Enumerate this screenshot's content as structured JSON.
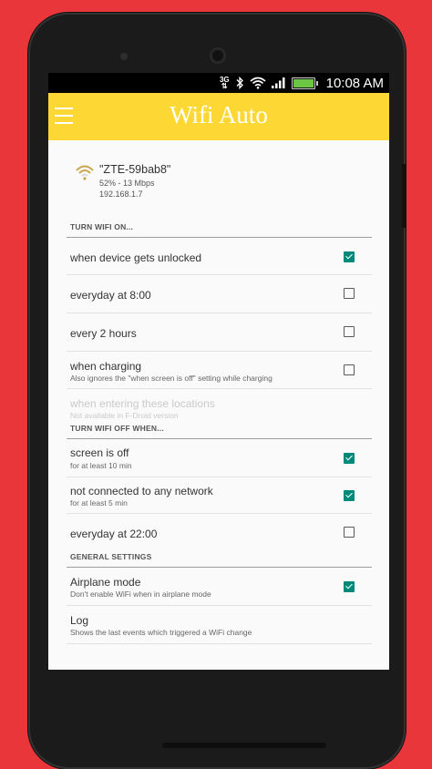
{
  "statusbar": {
    "network": "3G",
    "time": "10:08 AM",
    "battery_level": 1.0
  },
  "app": {
    "title": "Wifi Auto"
  },
  "wifi": {
    "ssid": "\"ZTE-59bab8\"",
    "signal": "52% - 13 Mbps",
    "ip": "192.168.1.7"
  },
  "sections": {
    "on": "TURN WIFI ON...",
    "off": "TURN WIFI OFF WHEN...",
    "general": "GENERAL SETTINGS"
  },
  "on_items": [
    {
      "title": "when device gets unlocked",
      "checked": true
    },
    {
      "title": "everyday at 8:00",
      "checked": false
    },
    {
      "title": "every 2 hours",
      "checked": false
    },
    {
      "title": "when charging",
      "summary": "Also ignores the \"when screen is off\" setting while charging",
      "checked": false
    },
    {
      "title": "when entering these locations",
      "summary": "Not available in F-Droid version",
      "enabled": false
    }
  ],
  "off_items": [
    {
      "title": "screen is off",
      "summary": "for at least 10 min",
      "checked": true
    },
    {
      "title": "not connected to any network",
      "summary": "for at least 5 min",
      "checked": true
    },
    {
      "title": "everyday at 22:00",
      "checked": false
    }
  ],
  "general_items": [
    {
      "title": "Airplane mode",
      "summary": "Don't enable WiFi when in airplane mode",
      "checked": true
    },
    {
      "title": "Log",
      "summary": "Shows the last events which triggered a WiFi change"
    }
  ],
  "colors": {
    "accent": "#fdd835",
    "checkbox": "#00897b",
    "background": "#e8363b"
  }
}
